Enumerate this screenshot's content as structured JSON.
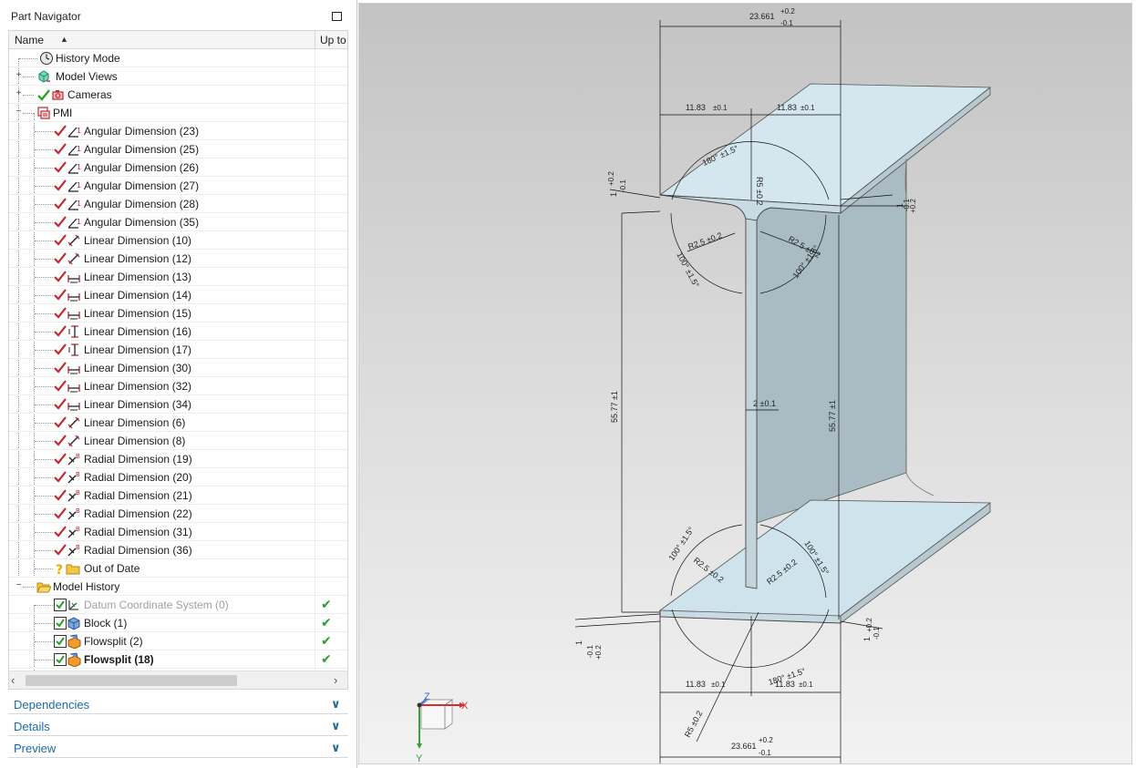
{
  "navigator": {
    "title": "Part Navigator",
    "columns": {
      "name": "Name",
      "up_to_date": "Up to"
    },
    "rows": [
      {
        "label": "History Mode"
      },
      {
        "label": "Model Views"
      },
      {
        "label": "Cameras"
      },
      {
        "label": "PMI"
      },
      {
        "label": "Angular Dimension (23)"
      },
      {
        "label": "Angular Dimension (25)"
      },
      {
        "label": "Angular Dimension (26)"
      },
      {
        "label": "Angular Dimension (27)"
      },
      {
        "label": "Angular Dimension (28)"
      },
      {
        "label": "Angular Dimension (35)"
      },
      {
        "label": "Linear Dimension (10)"
      },
      {
        "label": "Linear Dimension (12)"
      },
      {
        "label": "Linear Dimension (13)"
      },
      {
        "label": "Linear Dimension (14)"
      },
      {
        "label": "Linear Dimension (15)"
      },
      {
        "label": "Linear Dimension (16)"
      },
      {
        "label": "Linear Dimension (17)"
      },
      {
        "label": "Linear Dimension (30)"
      },
      {
        "label": "Linear Dimension (32)"
      },
      {
        "label": "Linear Dimension (34)"
      },
      {
        "label": "Linear Dimension (6)"
      },
      {
        "label": "Linear Dimension (8)"
      },
      {
        "label": "Radial Dimension (19)"
      },
      {
        "label": "Radial Dimension (20)"
      },
      {
        "label": "Radial Dimension (21)"
      },
      {
        "label": "Radial Dimension (22)"
      },
      {
        "label": "Radial Dimension (31)"
      },
      {
        "label": "Radial Dimension (36)"
      },
      {
        "label": "Out of Date"
      },
      {
        "label": "Model History"
      },
      {
        "label": "Datum Coordinate System (0)"
      },
      {
        "label": "Block (1)"
      },
      {
        "label": "Flowsplit (2)"
      },
      {
        "label": "Flowsplit (18)"
      }
    ],
    "sections": [
      {
        "label": "Dependencies"
      },
      {
        "label": "Details"
      },
      {
        "label": "Preview"
      }
    ]
  },
  "viewport": {
    "axes": {
      "x": "X",
      "y": "Y",
      "z": "Z"
    },
    "dimensions": {
      "top_width": "23.661",
      "top_width_tol_plus": "+0.2",
      "top_width_tol_minus": "-0.1",
      "top_half_left": "11.83",
      "top_half_left_tol": "±0.1",
      "top_half_right": "11.83",
      "top_half_right_tol": "±0.1",
      "top_angle": "180° ±1.5°",
      "top_radius": "R5 ±0.2",
      "left_flange": "1",
      "left_flange_tol_plus": "+0.2",
      "left_flange_tol_minus": "-0.1",
      "right_flange": "1",
      "right_flange_tol_plus": "+0.2",
      "right_flange_tol_minus": "-0.1",
      "fillet_left": "R2.5 ±0.2",
      "fillet_right": "R2.5 ±0.2",
      "angle_left": "100° ±1.5°",
      "angle_right": "100° ±1.5°",
      "height_left": "55.77 ±1",
      "height_right": "55.77 ±1",
      "web": "2 ±0.1",
      "bottom_angle_left": "100° ±1.5°",
      "bottom_angle_right": "100° ±1.5°",
      "bottom_fillet_left": "R2.5 ±0.2",
      "bottom_fillet_right": "R2.5 ±0.2",
      "bottom_angle": "180° ±1.5°",
      "bottom_half_left": "11.83",
      "bottom_half_left_tol": "±0.1",
      "bottom_half_right": "11.83",
      "bottom_half_right_tol": "±0.1",
      "bottom_radius": "R5 ±0.2",
      "bottom_width": "23.661",
      "bottom_width_tol_plus": "+0.2",
      "bottom_width_tol_minus": "-0.1",
      "bottom_left_flange": "1",
      "bottom_left_flange_tol_plus": "+0.2",
      "bottom_left_flange_tol_minus": "-0.1",
      "bottom_right_flange": "1",
      "bottom_right_flange_tol_plus": "+0.2",
      "bottom_right_flange_tol_minus": "-0.1"
    }
  }
}
